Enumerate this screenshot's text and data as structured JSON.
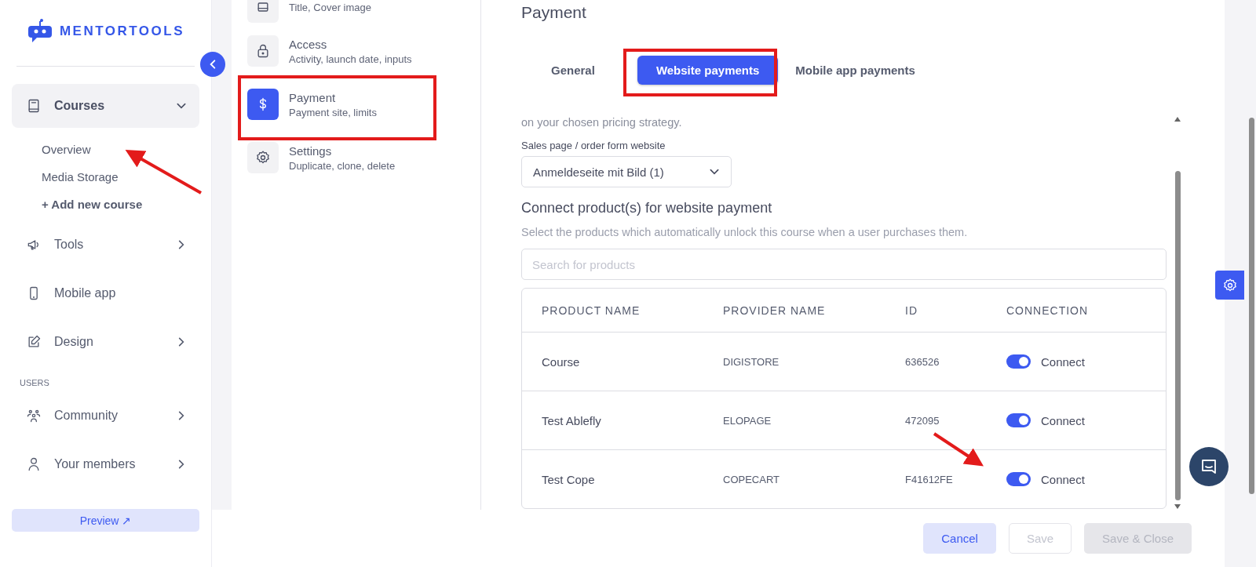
{
  "logo": {
    "text": "MENTORTOOLS"
  },
  "sidebar": {
    "items": [
      {
        "kind": "item",
        "label": "Courses",
        "selected": true,
        "expanded": true,
        "children": [
          {
            "kind": "link",
            "label": "Overview"
          },
          {
            "kind": "link",
            "label": "Media Storage"
          },
          {
            "kind": "action",
            "label": "+ Add new course"
          }
        ]
      },
      {
        "kind": "item",
        "label": "Tools",
        "selected": false,
        "expanded": false
      },
      {
        "kind": "item",
        "label": "Mobile app",
        "selected": false
      },
      {
        "kind": "item",
        "label": "Design",
        "selected": false,
        "expanded": false
      },
      {
        "kind": "section",
        "label": "USERS"
      },
      {
        "kind": "item",
        "label": "Community",
        "selected": false,
        "expanded": false
      },
      {
        "kind": "item",
        "label": "Your members",
        "selected": false,
        "expanded": false
      }
    ],
    "preview_button": "Preview ↗"
  },
  "settings_menu": {
    "items": [
      {
        "subtitle": "Title, Cover image",
        "selected": false
      },
      {
        "title": "Access",
        "subtitle": "Activity, launch date, inputs",
        "selected": false
      },
      {
        "title": "Payment",
        "subtitle": "Payment site, limits",
        "selected": true
      },
      {
        "title": "Settings",
        "subtitle": "Duplicate, clone, delete",
        "selected": false
      }
    ]
  },
  "content": {
    "title": "Payment",
    "tabs": [
      {
        "label": "General",
        "selected": false
      },
      {
        "label": "Website payments",
        "selected": true
      },
      {
        "label": "Mobile app payments",
        "selected": false
      }
    ],
    "intro_text": "on your chosen pricing strategy.",
    "sales_page": {
      "label": "Sales page / order form website",
      "value": "Anmeldeseite mit Bild (1)"
    },
    "products": {
      "heading": "Connect product(s) for website payment",
      "description": "Select the products which automatically unlock this course when a user purchases them.",
      "search": {
        "placeholder": "Search for products"
      },
      "table": {
        "columns": [
          "PRODUCT NAME",
          "PROVIDER NAME",
          "ID",
          "CONNECTION"
        ],
        "rows": [
          {
            "product": "Course",
            "provider": "DIGISTORE",
            "id": "636526",
            "on": true,
            "toggle_label": "Connect"
          },
          {
            "product": "Test Ablefly",
            "provider": "ELOPAGE",
            "id": "472095",
            "on": true,
            "toggle_label": "Connect"
          },
          {
            "product": "Test Cope",
            "provider": "COPECART",
            "id": "F41612FE",
            "on": true,
            "toggle_label": "Connect"
          }
        ]
      }
    }
  },
  "footer": {
    "buttons": [
      {
        "label": "Cancel",
        "kind": "secondary",
        "disabled": false
      },
      {
        "label": "Save",
        "kind": "outline",
        "disabled": true
      },
      {
        "label": "Save & Close",
        "kind": "primary",
        "disabled": true
      }
    ]
  }
}
